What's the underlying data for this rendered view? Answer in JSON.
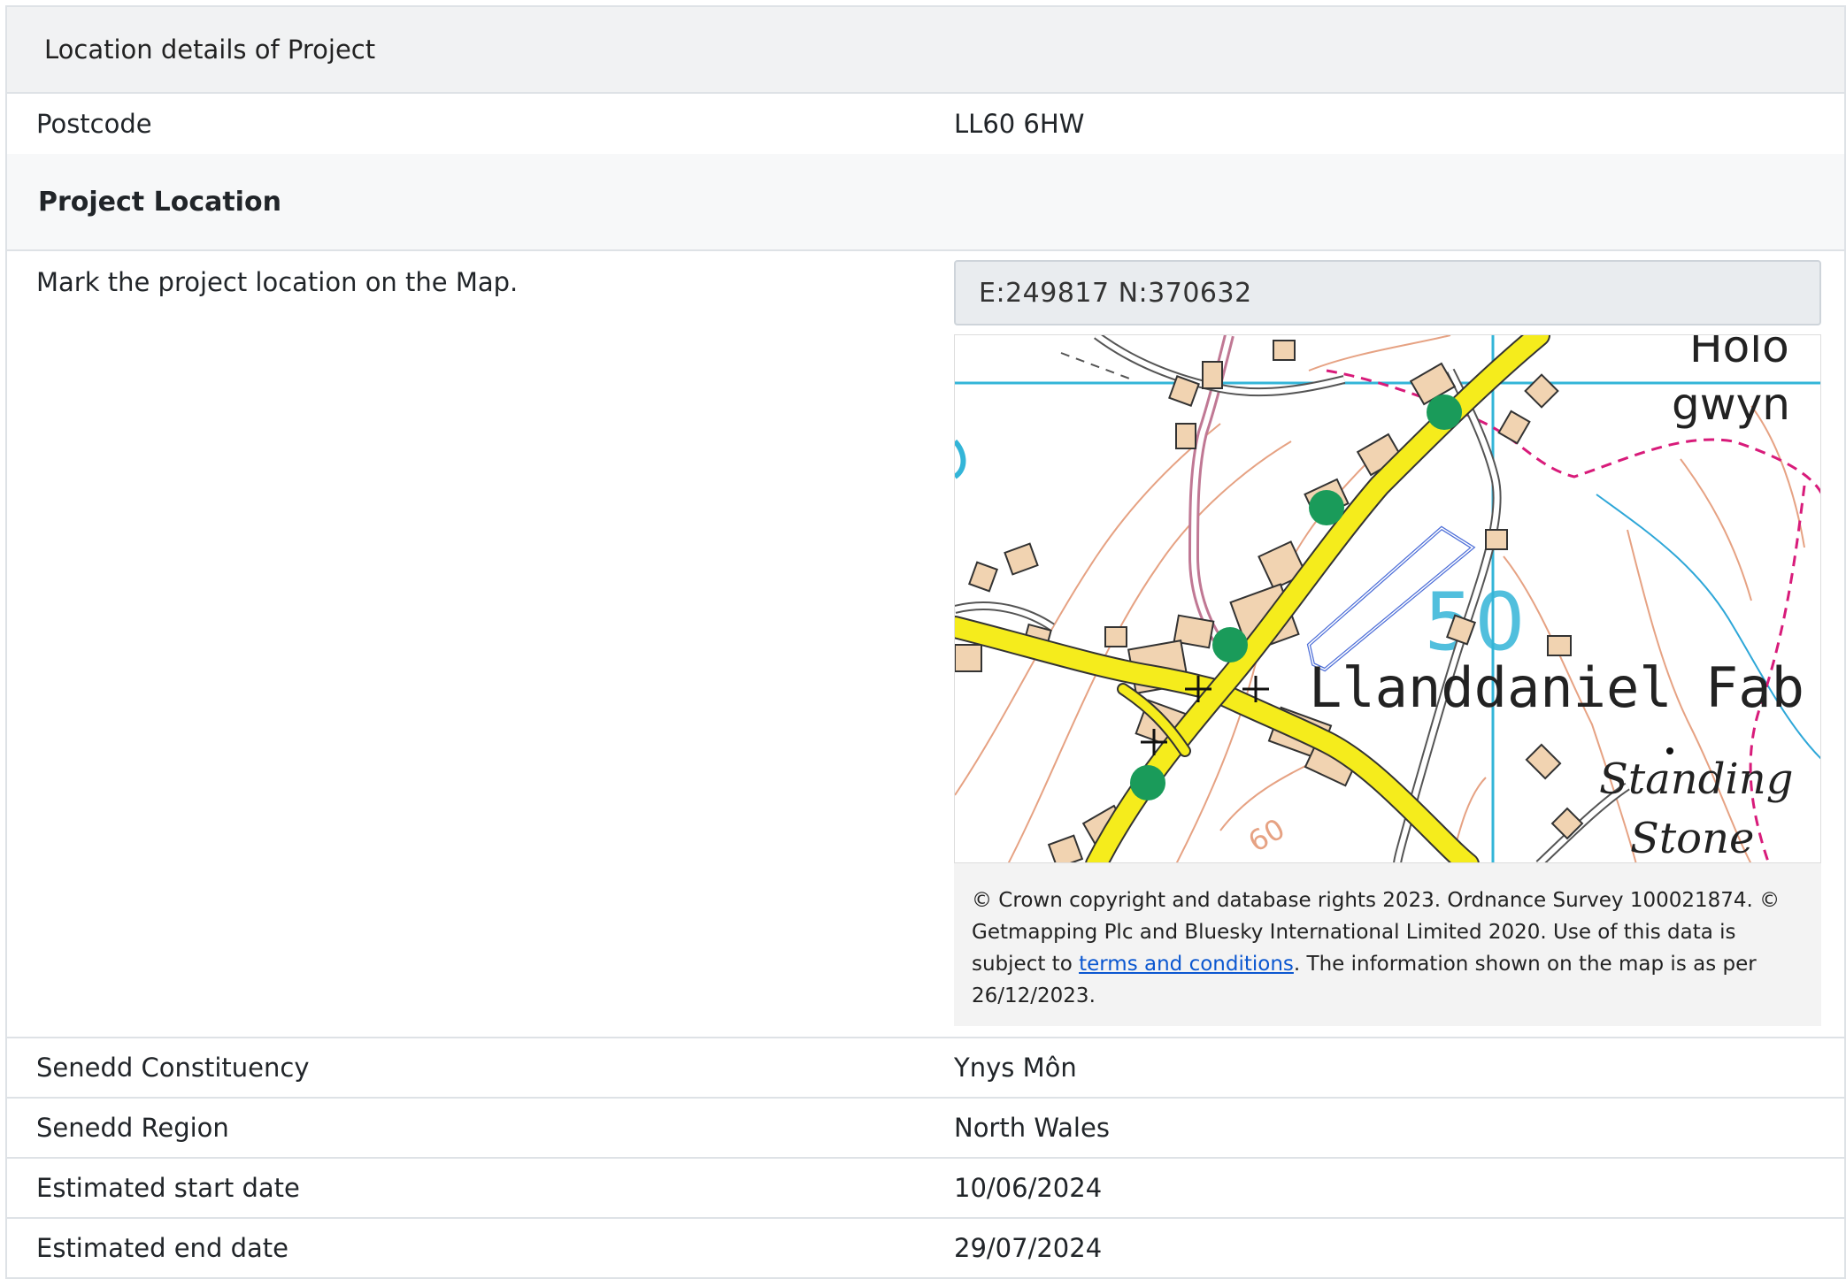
{
  "panel": {
    "title": "Location details of Project"
  },
  "postcode": {
    "label": "Postcode",
    "value": "LL60 6HW"
  },
  "project_location": {
    "heading": "Project Location",
    "instruction": "Mark the project location on the Map.",
    "coordinates": "E:249817  N:370632",
    "map": {
      "place_label": "Llanddaniel Fab",
      "label_top_right_1": "Holo",
      "label_top_right_2": "gwyn",
      "label_standing": "Standing",
      "label_stone": "Stone",
      "grid_number": "50",
      "contour_number": "60"
    },
    "attribution": {
      "text_before_link": "© Crown copyright and database rights 2023. Ordnance Survey 100021874. © Getmapping Plc and Bluesky International Limited 2020. Use of this data is subject to ",
      "link_text": "terms and conditions",
      "text_after_link": ". The information shown on the map is as per 26/12/2023."
    }
  },
  "rows": [
    {
      "label": "Senedd Constituency",
      "value": "Ynys Môn"
    },
    {
      "label": "Senedd Region",
      "value": "North Wales"
    },
    {
      "label": "Estimated start date",
      "value": "10/06/2024"
    },
    {
      "label": "Estimated end date",
      "value": "29/07/2024"
    }
  ],
  "colors": {
    "road_yellow": "#f5ec1c",
    "building_tan": "#f1d3b1",
    "grid_blue": "#33b5d8",
    "footpath_magenta": "#d81b7a",
    "contour_orange": "#e6a283",
    "marker_green": "#1a9b5a",
    "boundary_blue": "#4e6fd8"
  }
}
